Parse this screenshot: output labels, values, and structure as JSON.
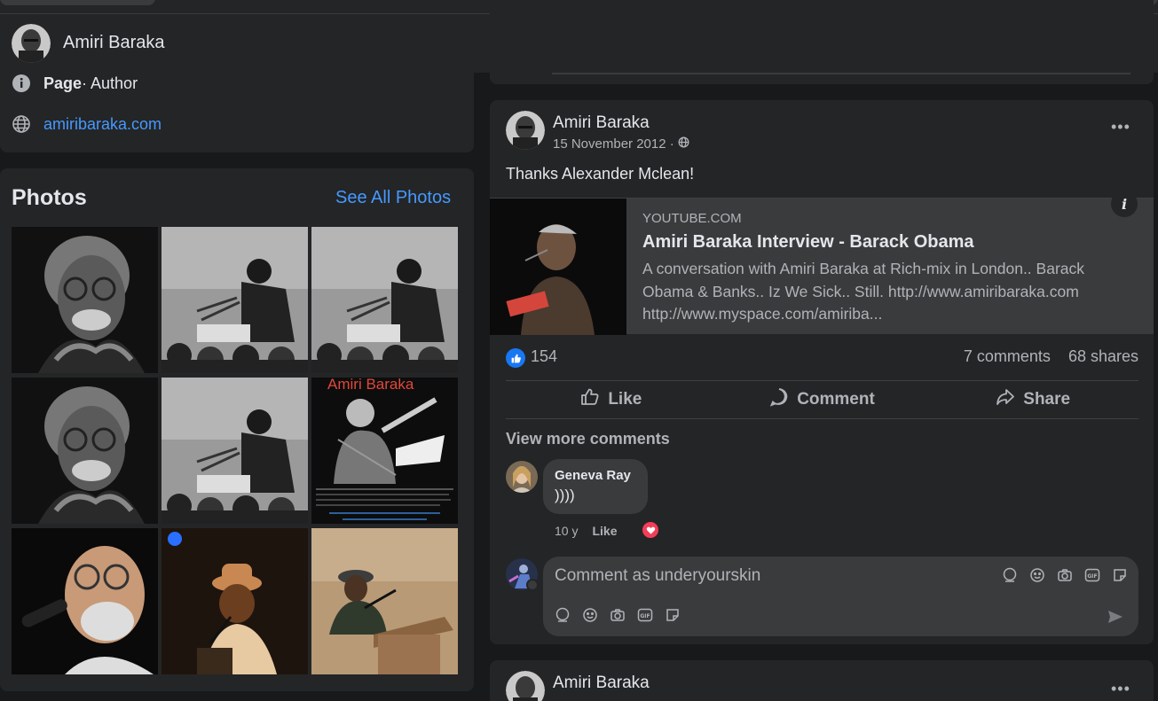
{
  "page": {
    "name": "Amiri Baraka",
    "more_label": "•••"
  },
  "info": {
    "type_label": "Page",
    "type_value": " · Author",
    "website": "amiribaraka.com"
  },
  "photos": {
    "title": "Photos",
    "see_all": "See All Photos",
    "poster_title": "Amiri Baraka"
  },
  "post": {
    "author": "Amiri Baraka",
    "date": "15 November 2012 ·",
    "text": "Thanks Alexander Mclean!",
    "more_label": "•••",
    "link": {
      "domain": "YOUTUBE.COM",
      "title": "Amiri Baraka Interview - Barack Obama",
      "description": "A conversation with Amiri Baraka at Rich-mix in London.. Barack Obama & Banks.. Iz We Sick.. Still. http://www.amiribaraka.com http://www.myspace.com/amiriba...",
      "info_label": "i"
    },
    "reactions_count": "154",
    "comments_count": "7 comments",
    "shares_count": "68 shares",
    "actions": {
      "like": "Like",
      "comment": "Comment",
      "share": "Share"
    },
    "view_more": "View more comments",
    "comment": {
      "name": "Geneva Ray",
      "text": "))))",
      "time": "10 y",
      "like": "Like"
    },
    "composer_placeholder": "Comment as underyourskin"
  },
  "post2": {
    "author": "Amiri Baraka",
    "more_label": "•••"
  },
  "colors": {
    "background": "#18191a",
    "card": "#242526",
    "link": "#4599ff",
    "like_blue": "#1877f2",
    "heart": "#f33e58"
  }
}
